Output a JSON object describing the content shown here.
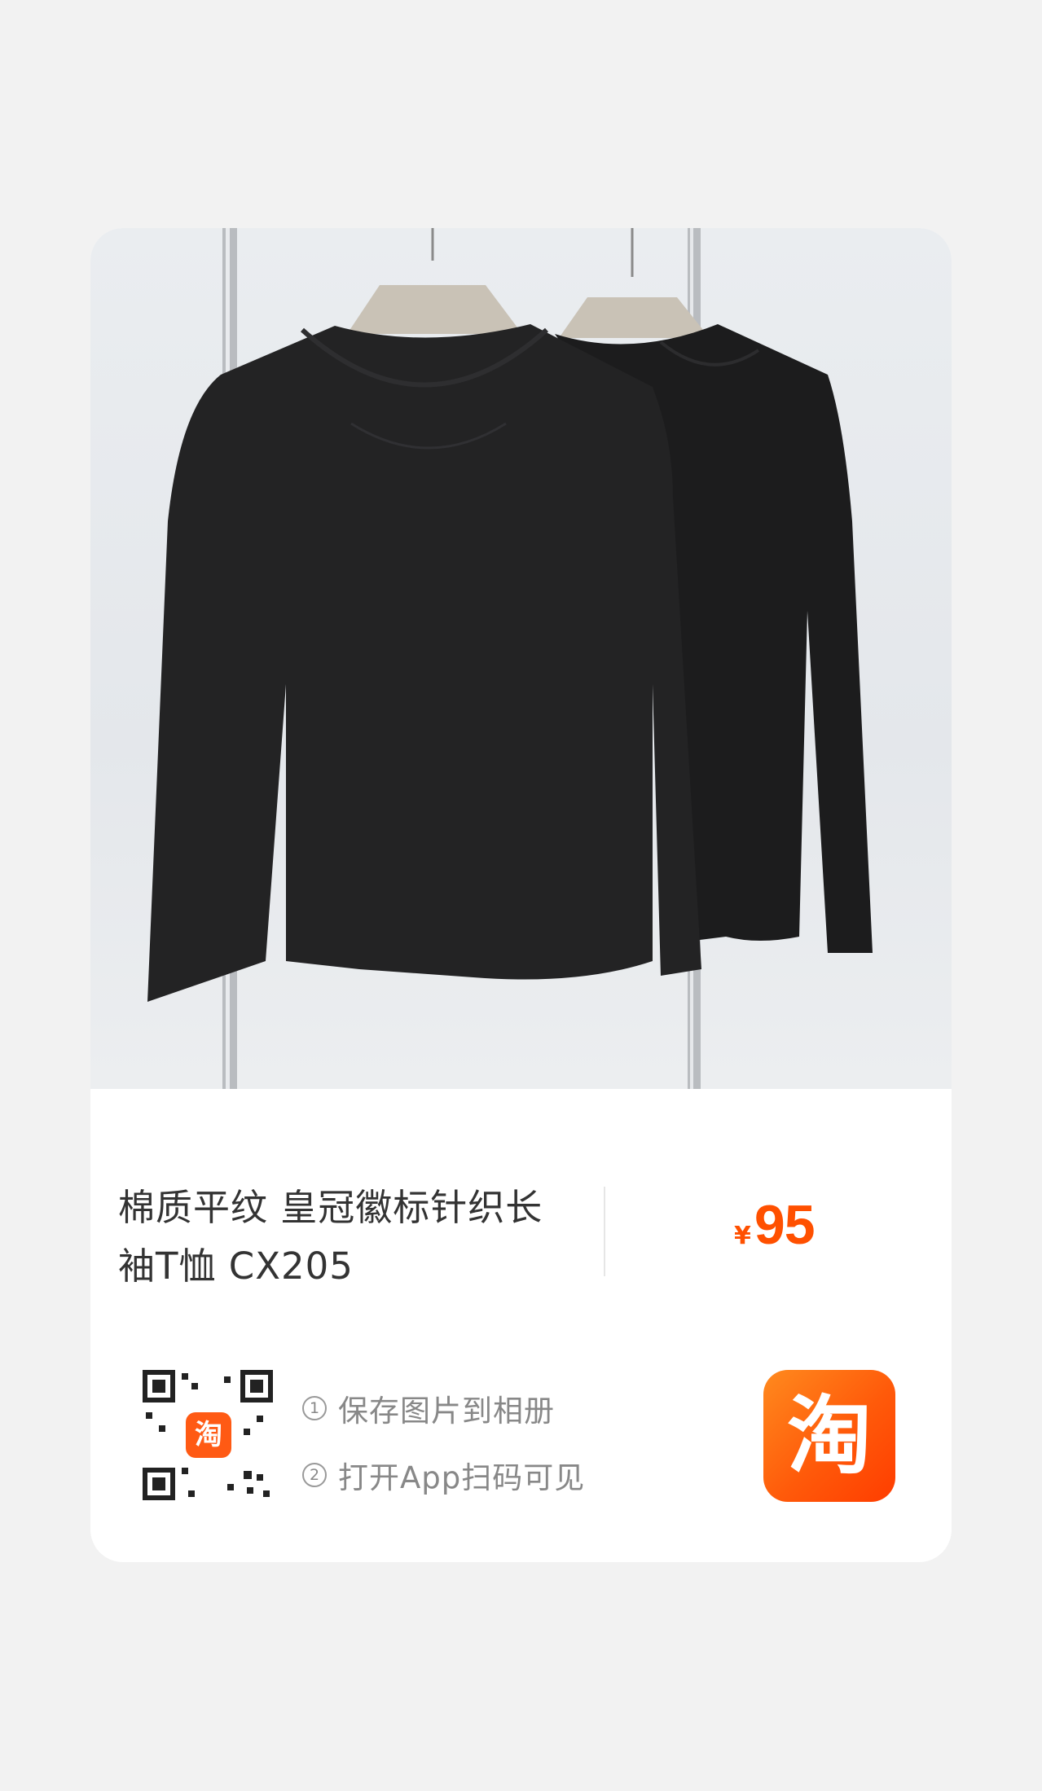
{
  "product": {
    "title": "棉质平纹 皇冠徽标针织长袖T恤 CX205",
    "currency_symbol": "¥",
    "price": "95"
  },
  "share": {
    "qr_logo_text": "淘",
    "step1_num": "①",
    "step1_text": "保存图片到相册",
    "step2_num": "②",
    "step2_text": "打开App扫码可见",
    "app_icon_text": "淘"
  },
  "colors": {
    "price": "#ff5000",
    "app_icon": "#ff5a0a",
    "background": "#f2f2f2",
    "card": "#ffffff"
  },
  "icons": [
    "taobao-qr-code",
    "taobao-app-icon",
    "product-photo-black-longsleeve-tshirts"
  ]
}
